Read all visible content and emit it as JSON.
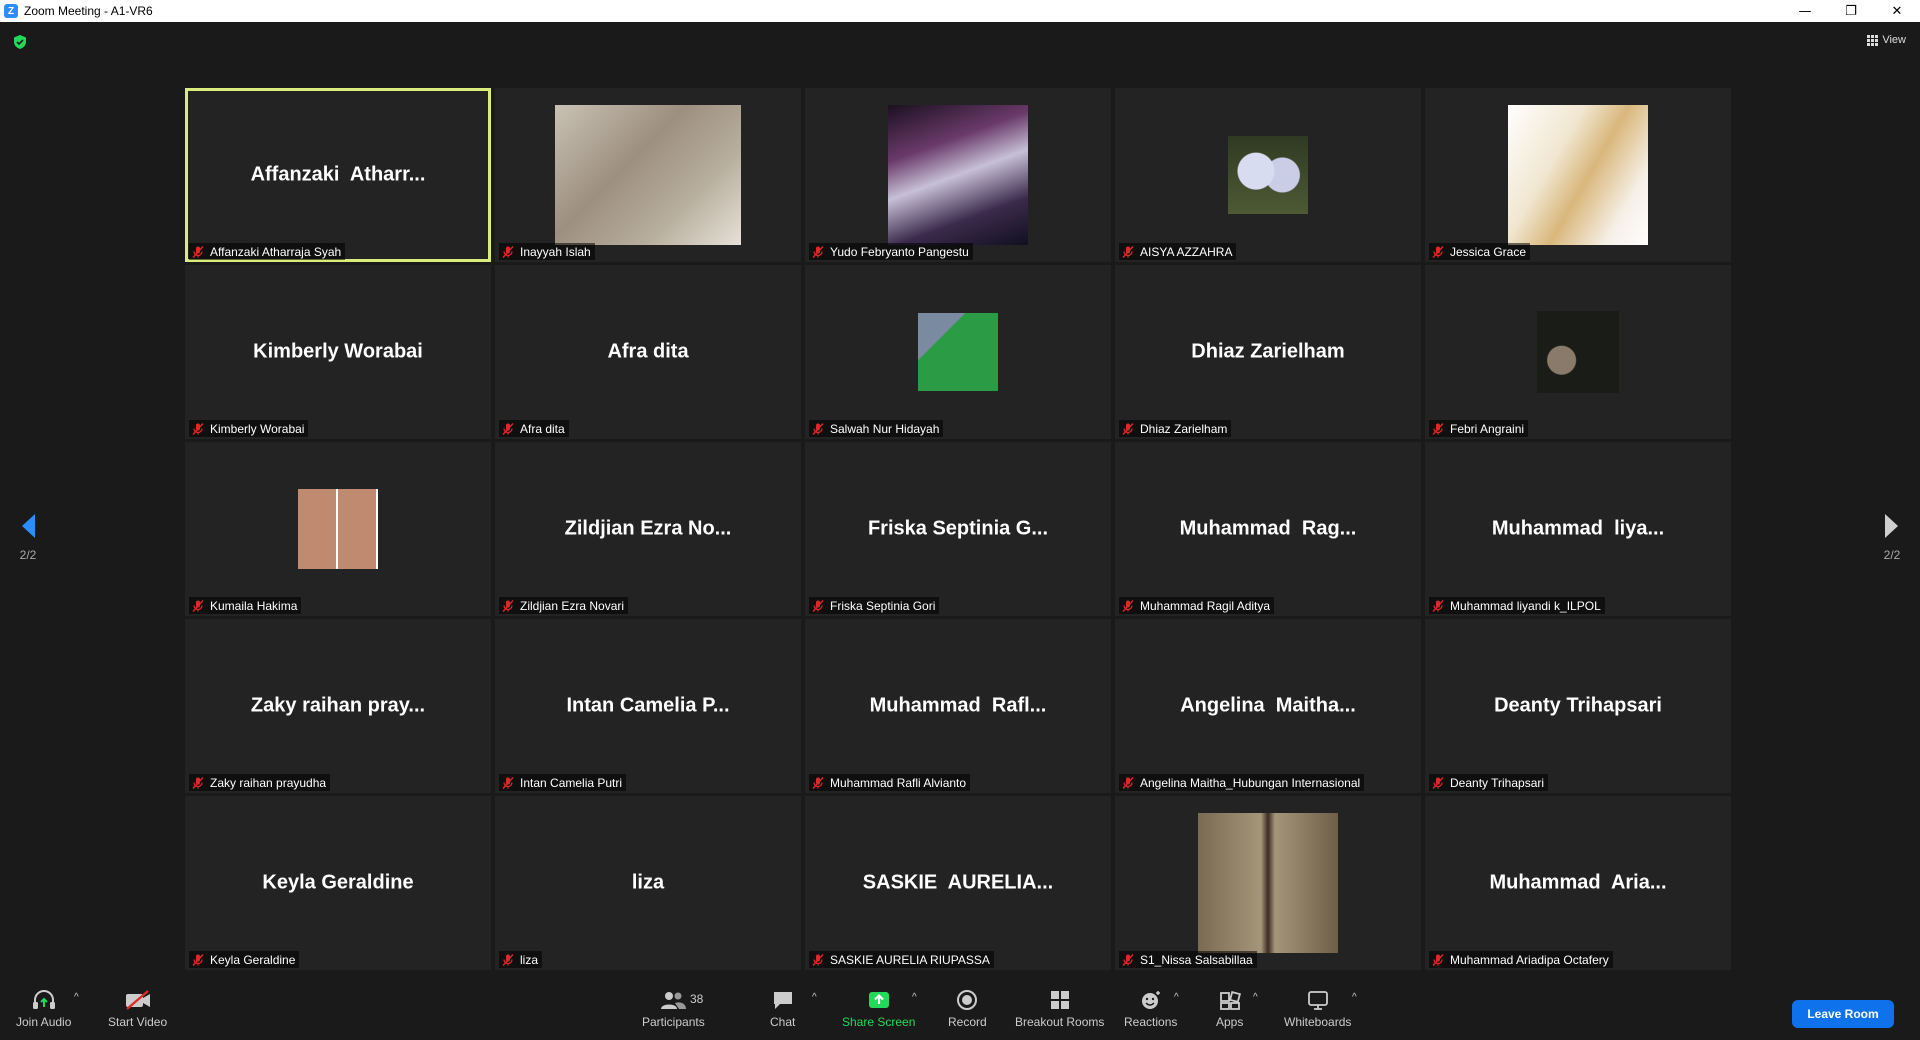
{
  "window": {
    "title": "Zoom Meeting - A1-VR6",
    "controls": [
      "—",
      "❐",
      "✕"
    ]
  },
  "header": {
    "view_label": "View"
  },
  "pagination": {
    "left_page": "2/2",
    "right_page": "2/2"
  },
  "participants": [
    {
      "display": "Affanzaki  Atharr...",
      "label": "Affanzaki Atharraja Syah",
      "active": true,
      "picture": ""
    },
    {
      "display": "",
      "label": "Inayyah Islah",
      "picture": "video-feed"
    },
    {
      "display": "",
      "label": "Yudo Febryanto Pangestu",
      "picture": "video-feed"
    },
    {
      "display": "",
      "label": "AISYA AZZAHRA",
      "picture": "profile-photo"
    },
    {
      "display": "",
      "label": "Jessica Grace",
      "picture": "profile-photo"
    },
    {
      "display": "Kimberly Worabai",
      "label": "Kimberly Worabai",
      "picture": ""
    },
    {
      "display": "Afra dita",
      "label": "Afra dita",
      "picture": ""
    },
    {
      "display": "",
      "label": "Salwah Nur Hidayah",
      "picture": "profile-photo"
    },
    {
      "display": "Dhiaz Zarielham",
      "label": "Dhiaz Zarielham",
      "picture": ""
    },
    {
      "display": "",
      "label": "Febri Angraini",
      "picture": "profile-photo"
    },
    {
      "display": "",
      "label": "Kumaila Hakima",
      "picture": "profile-photo"
    },
    {
      "display": "Zildjian Ezra No...",
      "label": "Zildjian Ezra Novari",
      "picture": ""
    },
    {
      "display": "Friska Septinia G...",
      "label": "Friska Septinia Gori",
      "picture": ""
    },
    {
      "display": "Muhammad  Rag...",
      "label": "Muhammad Ragil Aditya",
      "picture": ""
    },
    {
      "display": "Muhammad  liya...",
      "label": "Muhammad liyandi k_ILPOL",
      "picture": ""
    },
    {
      "display": "Zaky raihan pray...",
      "label": "Zaky raihan prayudha",
      "picture": ""
    },
    {
      "display": "Intan Camelia P...",
      "label": "Intan Camelia Putri",
      "picture": ""
    },
    {
      "display": "Muhammad  Rafl...",
      "label": "Muhammad Rafli Alvianto",
      "picture": ""
    },
    {
      "display": "Angelina  Maitha...",
      "label": "Angelina Maitha_Hubungan Internasional",
      "picture": ""
    },
    {
      "display": "Deanty Trihapsari",
      "label": "Deanty Trihapsari",
      "picture": ""
    },
    {
      "display": "Keyla Geraldine",
      "label": "Keyla Geraldine",
      "picture": ""
    },
    {
      "display": "liza",
      "label": "liza",
      "picture": ""
    },
    {
      "display": "SASKIE  AURELIA...",
      "label": "SASKIE AURELIA RIUPASSA",
      "picture": ""
    },
    {
      "display": "",
      "label": "S1_Nissa Salsabillaa",
      "picture": "profile-photo"
    },
    {
      "display": "Muhammad  Aria...",
      "label": "Muhammad Ariadipa Octafery",
      "picture": ""
    }
  ],
  "toolbar": {
    "join_audio": "Join Audio",
    "start_video": "Start Video",
    "participants": "Participants",
    "participants_count": "38",
    "chat": "Chat",
    "share_screen": "Share Screen",
    "record": "Record",
    "breakout_rooms": "Breakout Rooms",
    "reactions": "Reactions",
    "apps": "Apps",
    "whiteboards": "Whiteboards",
    "leave_room": "Leave Room"
  },
  "colors": {
    "active_speaker_border": "#d8ed7c",
    "leave_button": "#0e72ed",
    "share_screen": "#23d959",
    "muted_mic": "#e02828"
  }
}
